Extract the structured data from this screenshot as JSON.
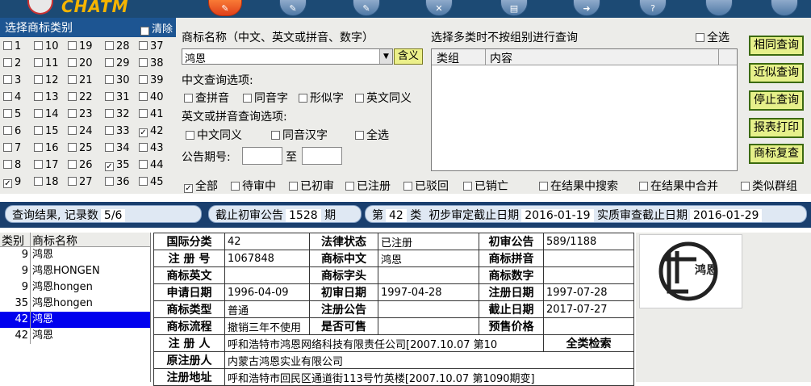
{
  "app": {
    "logo_text": "CHATM"
  },
  "toolbar": {
    "icons": [
      "edit-icon",
      "pen-icon",
      "pen2-icon",
      "close-icon",
      "print-icon",
      "export-icon",
      "help-icon",
      "blank1-icon",
      "blank2-icon"
    ]
  },
  "classes": {
    "title": "选择商标类别",
    "clear": "清除",
    "numbers": [
      [
        "1",
        "10",
        "19",
        "28",
        "37"
      ],
      [
        "2",
        "11",
        "20",
        "29",
        "38"
      ],
      [
        "3",
        "12",
        "21",
        "30",
        "39"
      ],
      [
        "4",
        "13",
        "22",
        "31",
        "40"
      ],
      [
        "5",
        "14",
        "23",
        "32",
        "41"
      ],
      [
        "6",
        "15",
        "24",
        "33",
        "42"
      ],
      [
        "7",
        "16",
        "25",
        "34",
        "43"
      ],
      [
        "8",
        "17",
        "26",
        "35",
        "44"
      ],
      [
        "9",
        "18",
        "27",
        "36",
        "45"
      ]
    ],
    "checked": [
      "9",
      "35",
      "42"
    ]
  },
  "search": {
    "name_label": "商标名称（中文、英文或拼音、数字）",
    "name_value": "鸿恩",
    "meaning_btn": "含义",
    "cn_options_label": "中文查询选项:",
    "cn_opts": [
      "查拼音",
      "同音字",
      "形似字",
      "英文同义"
    ],
    "en_options_label": "英文或拼音查询选项:",
    "en_opts": [
      "中文同义",
      "同音汉字",
      "全选"
    ],
    "period_label": "公告期号:",
    "to_label": "至",
    "multi_label": "选择多类时不按组别进行查询",
    "all_label": "全选",
    "list_cols": [
      "类组",
      "内容"
    ],
    "status_opts": [
      "全部",
      "待审中",
      "已初审",
      "已注册",
      "已驳回",
      "已销亡"
    ],
    "extra_opts": [
      "在结果中搜索",
      "在结果中合并",
      "类似群组"
    ]
  },
  "buttons": [
    "相同查询",
    "近似查询",
    "停止查询",
    "报表打印",
    "商标复查"
  ],
  "status": {
    "result_label": "查询结果, 记录数",
    "result_value": "5/6",
    "deadline_label": "截止初审公告",
    "deadline_value": "1528",
    "period_unit": "期",
    "class_prefix": "第",
    "class_value": "42",
    "class_suffix": "类",
    "prelim_label": "初步审定截止日期",
    "prelim_value": "2016-01-19",
    "sub_label": "实质审查截止日期",
    "sub_value": "2016-01-29"
  },
  "results": {
    "headers": [
      "类别",
      "商标名称"
    ],
    "rows": [
      {
        "cls": "9",
        "name": "鸿恩"
      },
      {
        "cls": "9",
        "name": "鸿恩HONGEN"
      },
      {
        "cls": "9",
        "name": "鸿恩hongen"
      },
      {
        "cls": "35",
        "name": "鸿恩hongen"
      },
      {
        "cls": "42",
        "name": "鸿恩",
        "selected": true
      },
      {
        "cls": "42",
        "name": "鸿恩"
      }
    ]
  },
  "detail": {
    "r1": [
      "国际分类",
      "42",
      "法律状态",
      "已注册",
      "初审公告",
      "589/1188"
    ],
    "r2": [
      "注 册 号",
      "1067848",
      "商标中文",
      "鸿恩",
      "商标拼音",
      ""
    ],
    "r3": [
      "商标英文",
      "",
      "商标字头",
      "",
      "商标数字",
      ""
    ],
    "r4": [
      "申请日期",
      "1996-04-09",
      "初审日期",
      "1997-04-28",
      "注册日期",
      "1997-07-28"
    ],
    "r5": [
      "商标类型",
      "普通",
      "注册公告",
      "",
      "截止日期",
      "2017-07-27"
    ],
    "r6": [
      "商标流程",
      "撤销三年不使用",
      "是否可售",
      "",
      "预售价格",
      ""
    ],
    "r7": [
      "注 册 人",
      "呼和浩特市鸿恩网络科技有限责任公司[2007.10.07 第10",
      "全类检索"
    ],
    "r8": [
      "原注册人",
      "内蒙古鸿恩实业有限公司"
    ],
    "r9": [
      "注册地址",
      "呼和浩特市回民区通道街113号竹英楼[2007.10.07 第1090期变]"
    ]
  },
  "logo_mark_text": "鸿恩"
}
